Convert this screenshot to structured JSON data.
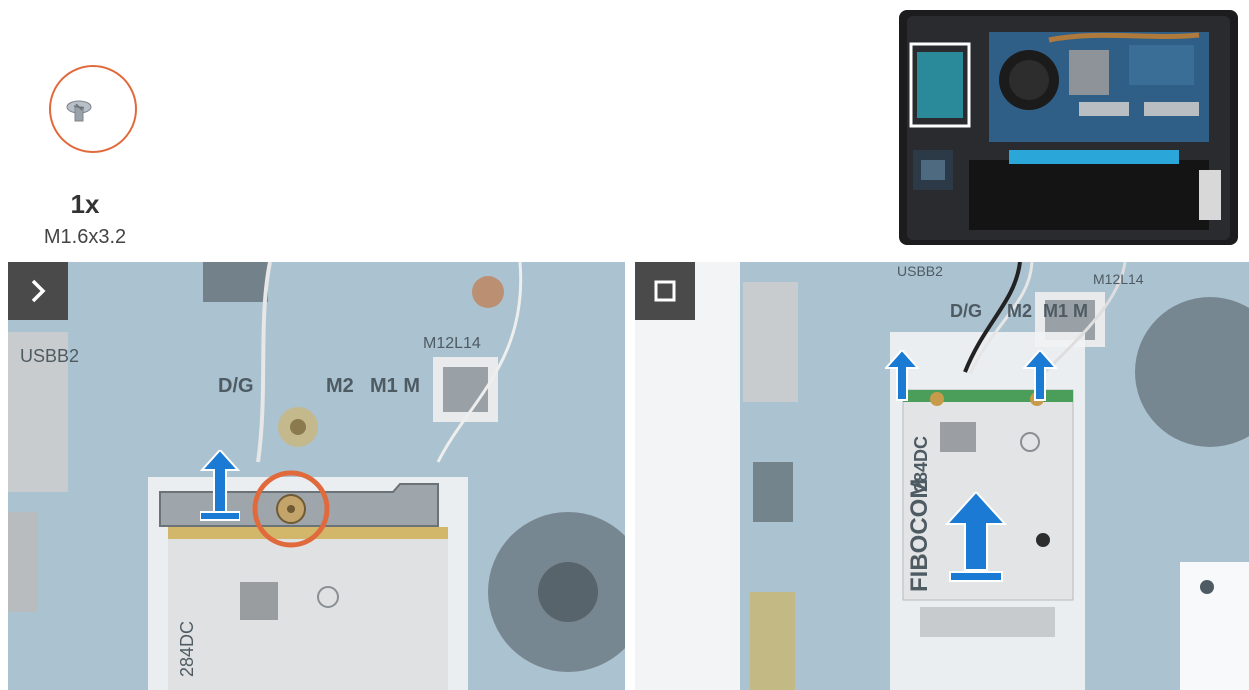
{
  "screw": {
    "count": "1x",
    "size": "M1.6x3.2"
  },
  "board_labels": {
    "usb": "USBB2",
    "dg": "D/G",
    "m2": "M2",
    "m1m": "M1 M",
    "m12l14": "M12L14",
    "m12": "M12L14"
  },
  "card": {
    "model": "284DC",
    "brand": "FIBOCOM"
  },
  "colors": {
    "accent_orange": "#e06a3b",
    "arrow_blue": "#1a7ad4",
    "badge": "#4a4a4a",
    "board": "#5d8aa5"
  },
  "icons": {
    "step_next": "chevron-right-icon",
    "step_end": "stop-square-icon"
  }
}
